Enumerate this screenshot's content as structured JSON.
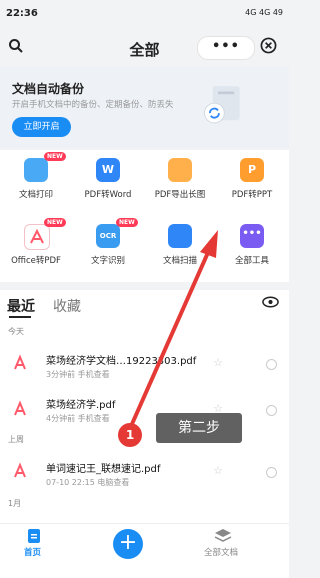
{
  "status": {
    "time": "22:36",
    "right": "4G 4G 49"
  },
  "header": {
    "title": "全部",
    "more": "•••"
  },
  "backup": {
    "title": "文档自动备份",
    "desc": "开启手机文档中的备份、定期备份、防丢失",
    "button": "立即开启"
  },
  "tools": [
    {
      "label": "文档打印",
      "badge": "NEW",
      "color": "#4aa9f4"
    },
    {
      "label": "PDF转Word",
      "badge": "",
      "color": "#2f86f6"
    },
    {
      "label": "PDF导出长图",
      "badge": "",
      "color": "#ffb04a"
    },
    {
      "label": "PDF转PPT",
      "badge": "",
      "color": "#ff9e2f"
    },
    {
      "label": "Office转PDF",
      "badge": "NEW",
      "color": "#ff5a6b"
    },
    {
      "label": "文字识别",
      "badge": "NEW",
      "color": "#3a9cf0"
    },
    {
      "label": "文档扫描",
      "badge": "",
      "color": "#2f86f6"
    },
    {
      "label": "全部工具",
      "badge": "",
      "color": "#7b5cf2"
    }
  ],
  "tabs": {
    "recent": "最近",
    "fav": "收藏"
  },
  "sections": {
    "today": "今天",
    "week": "上周",
    "month": "1月"
  },
  "files": [
    {
      "name": "菜场经济学文档…19223303.pdf",
      "meta": "3分钟前   手机查看"
    },
    {
      "name": "菜场经济学.pdf",
      "meta": "4分钟前   手机查看"
    },
    {
      "name": "单词速记王_联想速记.pdf",
      "meta": "07-10 22:15   电脑查看"
    }
  ],
  "nav": {
    "home": "首页",
    "all": "全部文档"
  },
  "annotation": {
    "step_num": "1",
    "step_text": "第二步"
  }
}
